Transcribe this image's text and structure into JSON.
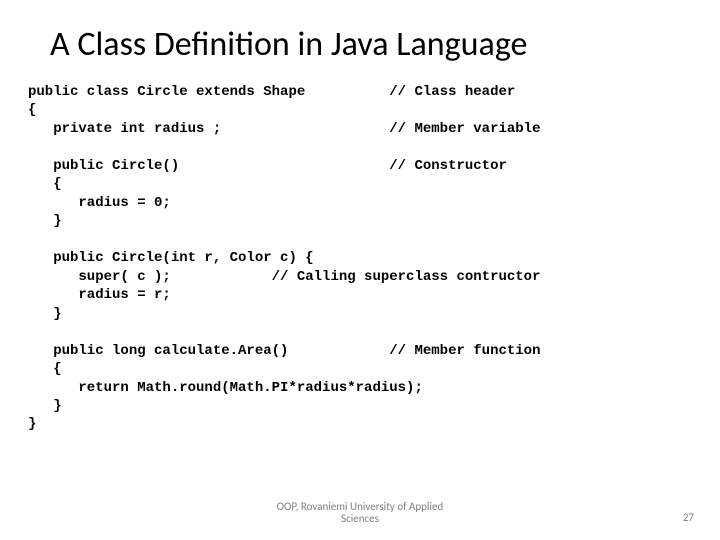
{
  "title": "A Class Definition in Java Language",
  "code": "public class Circle extends Shape          // Class header\n{\n   private int radius ;                    // Member variable\n\n   public Circle()                         // Constructor\n   {\n      radius = 0;\n   }\n\n   public Circle(int r, Color c) {\n      super( c );            // Calling superclass contructor\n      radius = r;\n   }\n\n   public long calculate.Area()            // Member function\n   {\n      return Math.round(Math.PI*radius*radius);\n   }\n}",
  "footer": {
    "center_line1": "OOP, Rovaniemi University of Applied",
    "center_line2": "Sciences",
    "page": "27"
  }
}
